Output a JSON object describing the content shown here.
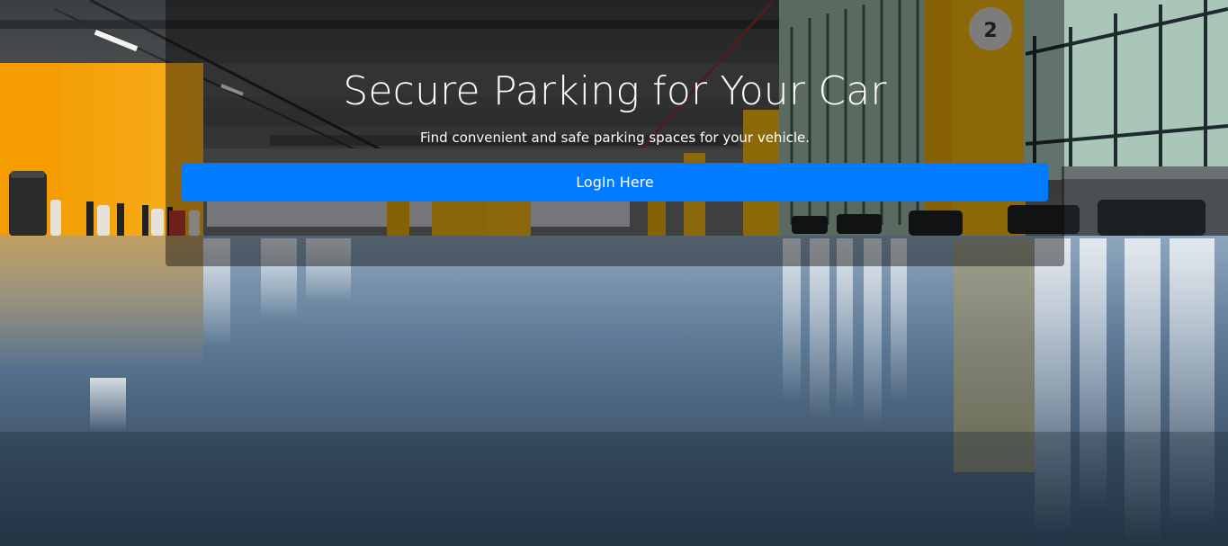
{
  "hero": {
    "title": "Secure Parking for Your Car",
    "subtitle": "Find convenient and safe parking spaces for your vehicle.",
    "login_label": "LogIn Here"
  },
  "background": {
    "pillar_number": "2"
  },
  "colors": {
    "primary_button": "#007bff",
    "wall_accent": "#f5a300",
    "floor": "#4a6886"
  }
}
